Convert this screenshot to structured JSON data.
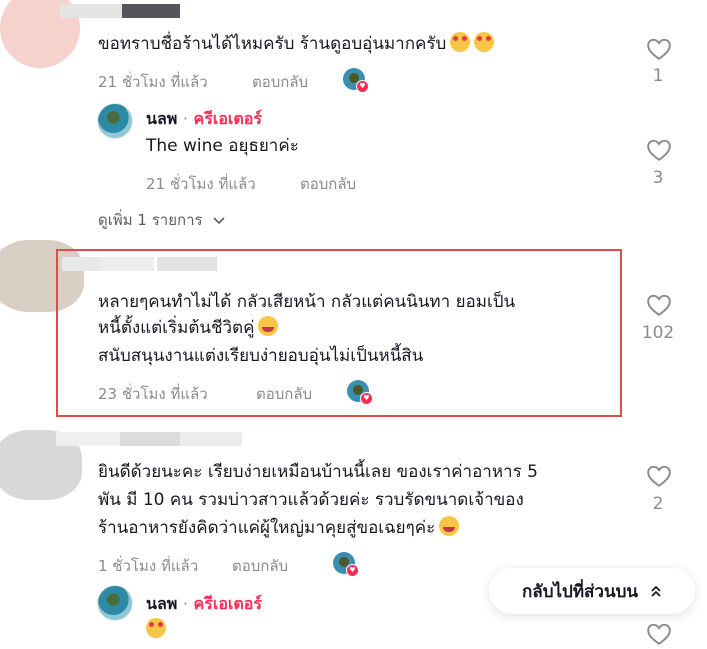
{
  "comments": [
    {
      "text_lines": [
        "ขอทราบชื่อร้านได้ไหมครับ ร้านดูอบอุ่นมากครับ"
      ],
      "time": "21 ชั่วโมง ที่แล้ว",
      "reply_label": "ตอบกลับ",
      "likes": "1",
      "replies": [
        {
          "username": "นลพ",
          "separator": "·",
          "role": "ครีเอเตอร์",
          "text": "The wine อยุธยาค่ะ",
          "time": "21 ชั่วโมง ที่แล้ว",
          "reply_label": "ตอบกลับ",
          "likes": "3"
        }
      ],
      "see_more": "ดูเพิ่ม 1 รายการ"
    },
    {
      "text_lines": [
        "หลายๆคนทำไม่ได้ กลัวเสียหน้า กลัวแต่คนนินทา ยอมเป็น",
        "หนี้ตั้งแต่เริ่มต้นชีวิตคู่",
        "สนับสนุนงานแต่งเรียบง่ายอบอุ่นไม่เป็นหนี้สิน"
      ],
      "time": "23 ชั่วโมง ที่แล้ว",
      "reply_label": "ตอบกลับ",
      "likes": "102"
    },
    {
      "text_lines": [
        "ยินดีด้วยนะคะ เรียบง่ายเหมือนบ้านนี้เลย ของเราค่าอาหาร 5",
        "พัน มี 10 คน รวมบ่าวสาวแล้วด้วยค่ะ รวบรัดขนาดเจ้าของ",
        "ร้านอาหารยังคิดว่าแค่ผู้ใหญ่มาคุยสู่ขอเฉยๆค่ะ"
      ],
      "time": "1 ชั่วโมง ที่แล้ว",
      "reply_label": "ตอบกลับ",
      "likes": "2",
      "replies": [
        {
          "username": "นลพ",
          "separator": "·",
          "role": "ครีเอเตอร์"
        }
      ]
    }
  ],
  "back_to_top": {
    "label": "กลับไปที่ส่วนบน",
    "icon": "double-chevron-up-icon"
  },
  "colors": {
    "creator": "#fe2c55",
    "highlight_border": "#e24b4b",
    "meta_gray": "#8a8b91"
  }
}
